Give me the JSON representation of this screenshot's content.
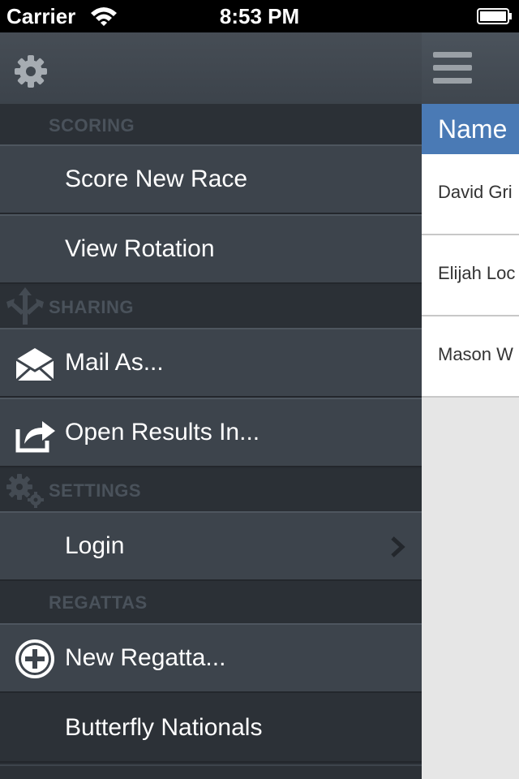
{
  "status_bar": {
    "carrier": "Carrier",
    "time": "8:53 PM"
  },
  "main_panel": {
    "column_header": "Name",
    "rows": [
      "David Gri",
      "Elijah Loc",
      "Mason W"
    ]
  },
  "drawer": {
    "sections": {
      "scoring": "SCORING",
      "sharing": "SHARING",
      "settings": "SETTINGS",
      "regattas": "REGATTAS"
    },
    "items": {
      "score_new_race": "Score New Race",
      "view_rotation": "View Rotation",
      "mail_as": "Mail As...",
      "open_results_in": "Open Results In...",
      "login": "Login",
      "new_regatta": "New Regatta...",
      "butterfly_nationals": "Butterfly Nationals"
    },
    "icons": {
      "top": "gear-icon",
      "sharing": "share-arrows-icon",
      "mail": "envelope-icon",
      "open_in": "open-in-icon",
      "settings": "gears-icon",
      "new_regatta": "plus-circle-icon",
      "login_disclosure": "chevron-right-icon"
    }
  },
  "colors": {
    "drawer_item": "#3d444c",
    "drawer_section": "#2b3036",
    "header_blue": "#4a7ab5",
    "main_bg": "#e6e6e6"
  }
}
